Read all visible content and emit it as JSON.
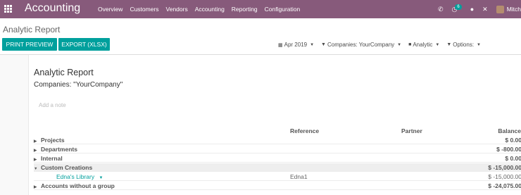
{
  "navbar": {
    "brand": "Accounting",
    "menu": [
      "Overview",
      "Customers",
      "Vendors",
      "Accounting",
      "Reporting",
      "Configuration"
    ],
    "activity_badge": "6",
    "user": "Mitch"
  },
  "control_panel": {
    "breadcrumb": "Analytic Report",
    "buttons": {
      "print_preview": "PRINT PREVIEW",
      "export": "EXPORT (XLSX)"
    },
    "filters": {
      "date": "Apr 2019",
      "companies": "Companies: YourCompany",
      "analytic": "Analytic",
      "options": "Options:"
    }
  },
  "report": {
    "title": "Analytic Report",
    "subtitle": "Companies: \"YourCompany\"",
    "note_placeholder": "Add a note",
    "columns": {
      "reference": "Reference",
      "partner": "Partner",
      "balance": "Balance"
    },
    "rows": [
      {
        "label": "Projects",
        "balance": "$ 0.00"
      },
      {
        "label": "Departments",
        "balance": "$ -800.00"
      },
      {
        "label": "Internal",
        "balance": "$ 0.00"
      },
      {
        "label": "Custom Creations",
        "balance": "$ -15,000.00"
      },
      {
        "label": "Edna's Library",
        "reference": "Edna1",
        "balance": "$ -15,000.00"
      },
      {
        "label": "Accounts without a group",
        "balance": "$ -24,075.00"
      }
    ]
  },
  "colors": {
    "navbar": "#875A7B",
    "accent": "#00A09D"
  }
}
